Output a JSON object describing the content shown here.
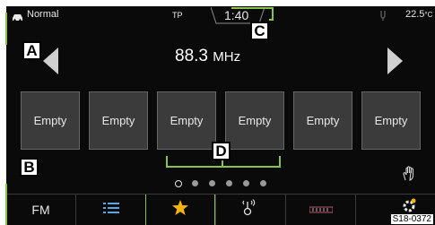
{
  "status_bar": {
    "profile": "Normal",
    "traffic_program": "TP",
    "clock": "1:40",
    "temperature": "22.5",
    "temperature_unit": "°C"
  },
  "station": {
    "frequency": "88.3",
    "unit": "MHz"
  },
  "presets": [
    "Empty",
    "Empty",
    "Empty",
    "Empty",
    "Empty",
    "Empty"
  ],
  "page_indicator": {
    "count": 6,
    "active": 0
  },
  "bottom_bar": {
    "fm_label": "FM",
    "icons": [
      "list-icon",
      "star-icon",
      "traffic-radio-icon",
      "signal-bar-icon",
      "settings-icon"
    ]
  },
  "callouts": {
    "a": "A",
    "b": "B",
    "c": "C",
    "d": "D"
  },
  "figure_id": "S18-0372",
  "colors": {
    "accent": "#f5b400",
    "frame_green": "#8bc34a",
    "screen_bg": "#0a0a0a",
    "tile_bg": "#3b3b3b"
  }
}
